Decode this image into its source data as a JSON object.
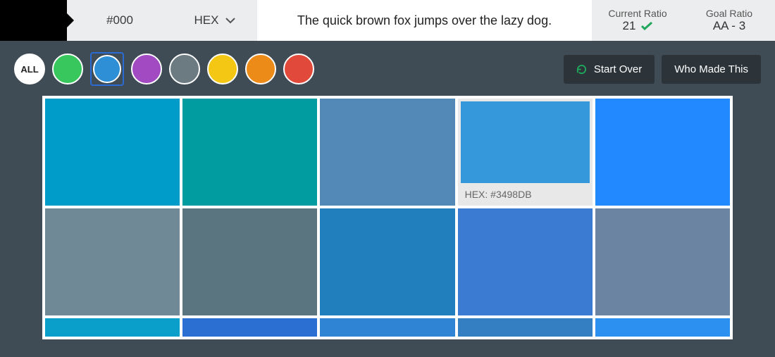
{
  "topbar": {
    "swatch_color": "#000",
    "hex_text": "#000",
    "format_label": "HEX",
    "sample_text": "The quick brown fox jumps over the lazy dog.",
    "current_ratio_label": "Current Ratio",
    "current_ratio_value": "21",
    "goal_ratio_label": "Goal Ratio",
    "goal_ratio_value": "AA - 3"
  },
  "filters": {
    "all_label": "ALL",
    "chips": [
      {
        "name": "green",
        "color": "#37c75c"
      },
      {
        "name": "blue",
        "color": "#2f8fd6",
        "selected": true
      },
      {
        "name": "purple",
        "color": "#a24ac2"
      },
      {
        "name": "gray",
        "color": "#6c7a82"
      },
      {
        "name": "yellow",
        "color": "#f4c714"
      },
      {
        "name": "orange",
        "color": "#ed8b18"
      },
      {
        "name": "red",
        "color": "#e14a3a"
      }
    ]
  },
  "actions": {
    "start_over": "Start Over",
    "who_made": "Who Made This"
  },
  "grid": {
    "hover_label_prefix": "HEX:",
    "rows": [
      [
        {
          "color": "#009cc9"
        },
        {
          "color": "#009ca0"
        },
        {
          "color": "#5289b6"
        },
        {
          "color": "#3498db",
          "hovered": true,
          "hex": "#3498DB"
        },
        {
          "color": "#2389ff"
        }
      ],
      [
        {
          "color": "#6f8a96"
        },
        {
          "color": "#5a7580"
        },
        {
          "color": "#207fbc"
        },
        {
          "color": "#3b7bd1"
        },
        {
          "color": "#6a84a2"
        }
      ],
      [
        {
          "color": "#0a9fca"
        },
        {
          "color": "#2a6fd1"
        },
        {
          "color": "#2f84d4"
        },
        {
          "color": "#347fc2"
        },
        {
          "color": "#2b90f0"
        }
      ]
    ]
  }
}
